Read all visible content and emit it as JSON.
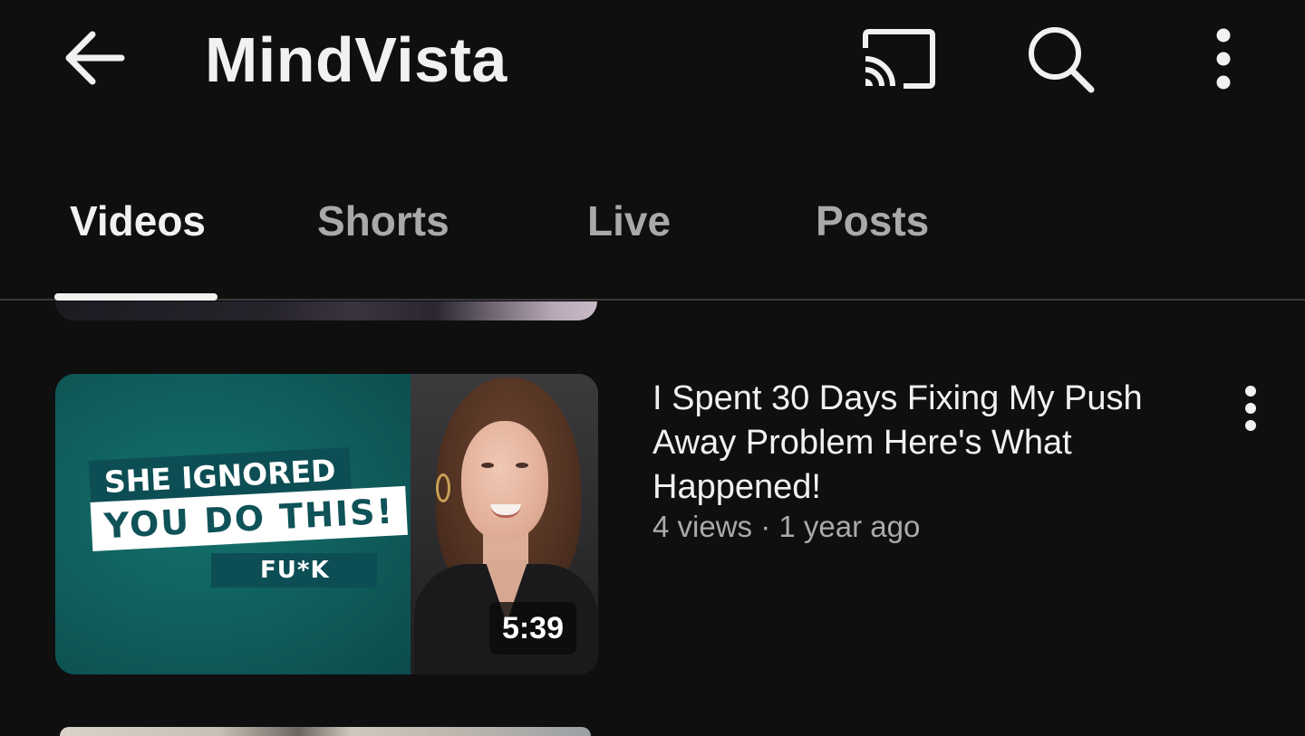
{
  "header": {
    "channel_name": "MindVista",
    "icons": {
      "back": "arrow-left-icon",
      "cast": "cast-icon",
      "search": "search-icon",
      "more": "more-vert-icon"
    }
  },
  "tabs": [
    {
      "label": "Videos",
      "active": true
    },
    {
      "label": "Shorts",
      "active": false
    },
    {
      "label": "Live",
      "active": false
    },
    {
      "label": "Posts",
      "active": false
    }
  ],
  "video": {
    "title": "I Spent 30 Days Fixing My Push Away Problem Here's What Happened!",
    "meta": "4 views · 1 year ago",
    "duration": "5:39",
    "thumbnail_text": {
      "line1": "SHE IGNORED",
      "line2": "YOU DO THIS!",
      "line3": "FU*K"
    }
  },
  "colors": {
    "background": "#0f0f0f",
    "text_primary": "#f1f1f1",
    "text_secondary": "#aaaaaa",
    "thumbnail_teal": "#0f5d5b"
  }
}
